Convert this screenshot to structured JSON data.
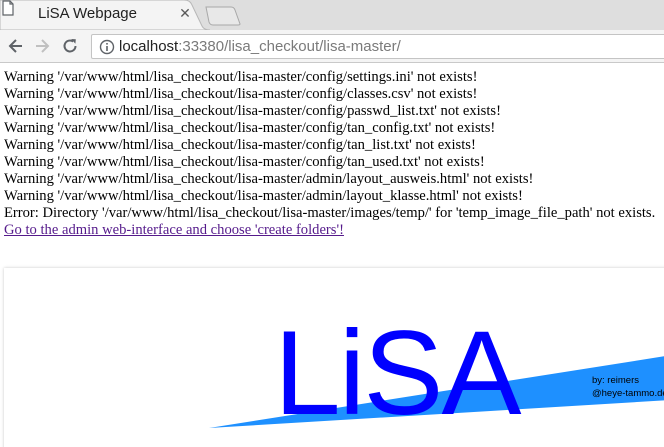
{
  "browser": {
    "tab": {
      "title": "LiSA Webpage",
      "close_icon": "close-icon"
    },
    "url": {
      "host": "localhost",
      "rest": ":33380/lisa_checkout/lisa-master/"
    },
    "icons": [
      "back-arrow-icon",
      "forward-arrow-icon",
      "reload-icon",
      "info-icon",
      "new-tab-icon"
    ]
  },
  "page": {
    "messages": [
      "Warning '/var/www/html/lisa_checkout/lisa-master/config/settings.ini' not exists!",
      "Warning '/var/www/html/lisa_checkout/lisa-master/config/classes.csv' not exists!",
      "Warning '/var/www/html/lisa_checkout/lisa-master/config/passwd_list.txt' not exists!",
      "Warning '/var/www/html/lisa_checkout/lisa-master/config/tan_config.txt' not exists!",
      "Warning '/var/www/html/lisa_checkout/lisa-master/config/tan_list.txt' not exists!",
      "Warning '/var/www/html/lisa_checkout/lisa-master/config/tan_used.txt' not exists!",
      "Warning '/var/www/html/lisa_checkout/lisa-master/admin/layout_ausweis.html' not exists!",
      "Warning '/var/www/html/lisa_checkout/lisa-master/admin/layout_klasse.html' not exists!",
      "Error: Directory '/var/www/html/lisa_checkout/lisa-master/images/temp/' for 'temp_image_file_path' not exists."
    ],
    "admin_link": "Go to the admin web-interface and choose 'create folders'!",
    "logo": {
      "text": "LiSA",
      "byline_1": "by: reimers",
      "byline_2": "@heye-tammo.de",
      "text_color": "#0000ff",
      "accent_color": "#1e90ff"
    }
  }
}
